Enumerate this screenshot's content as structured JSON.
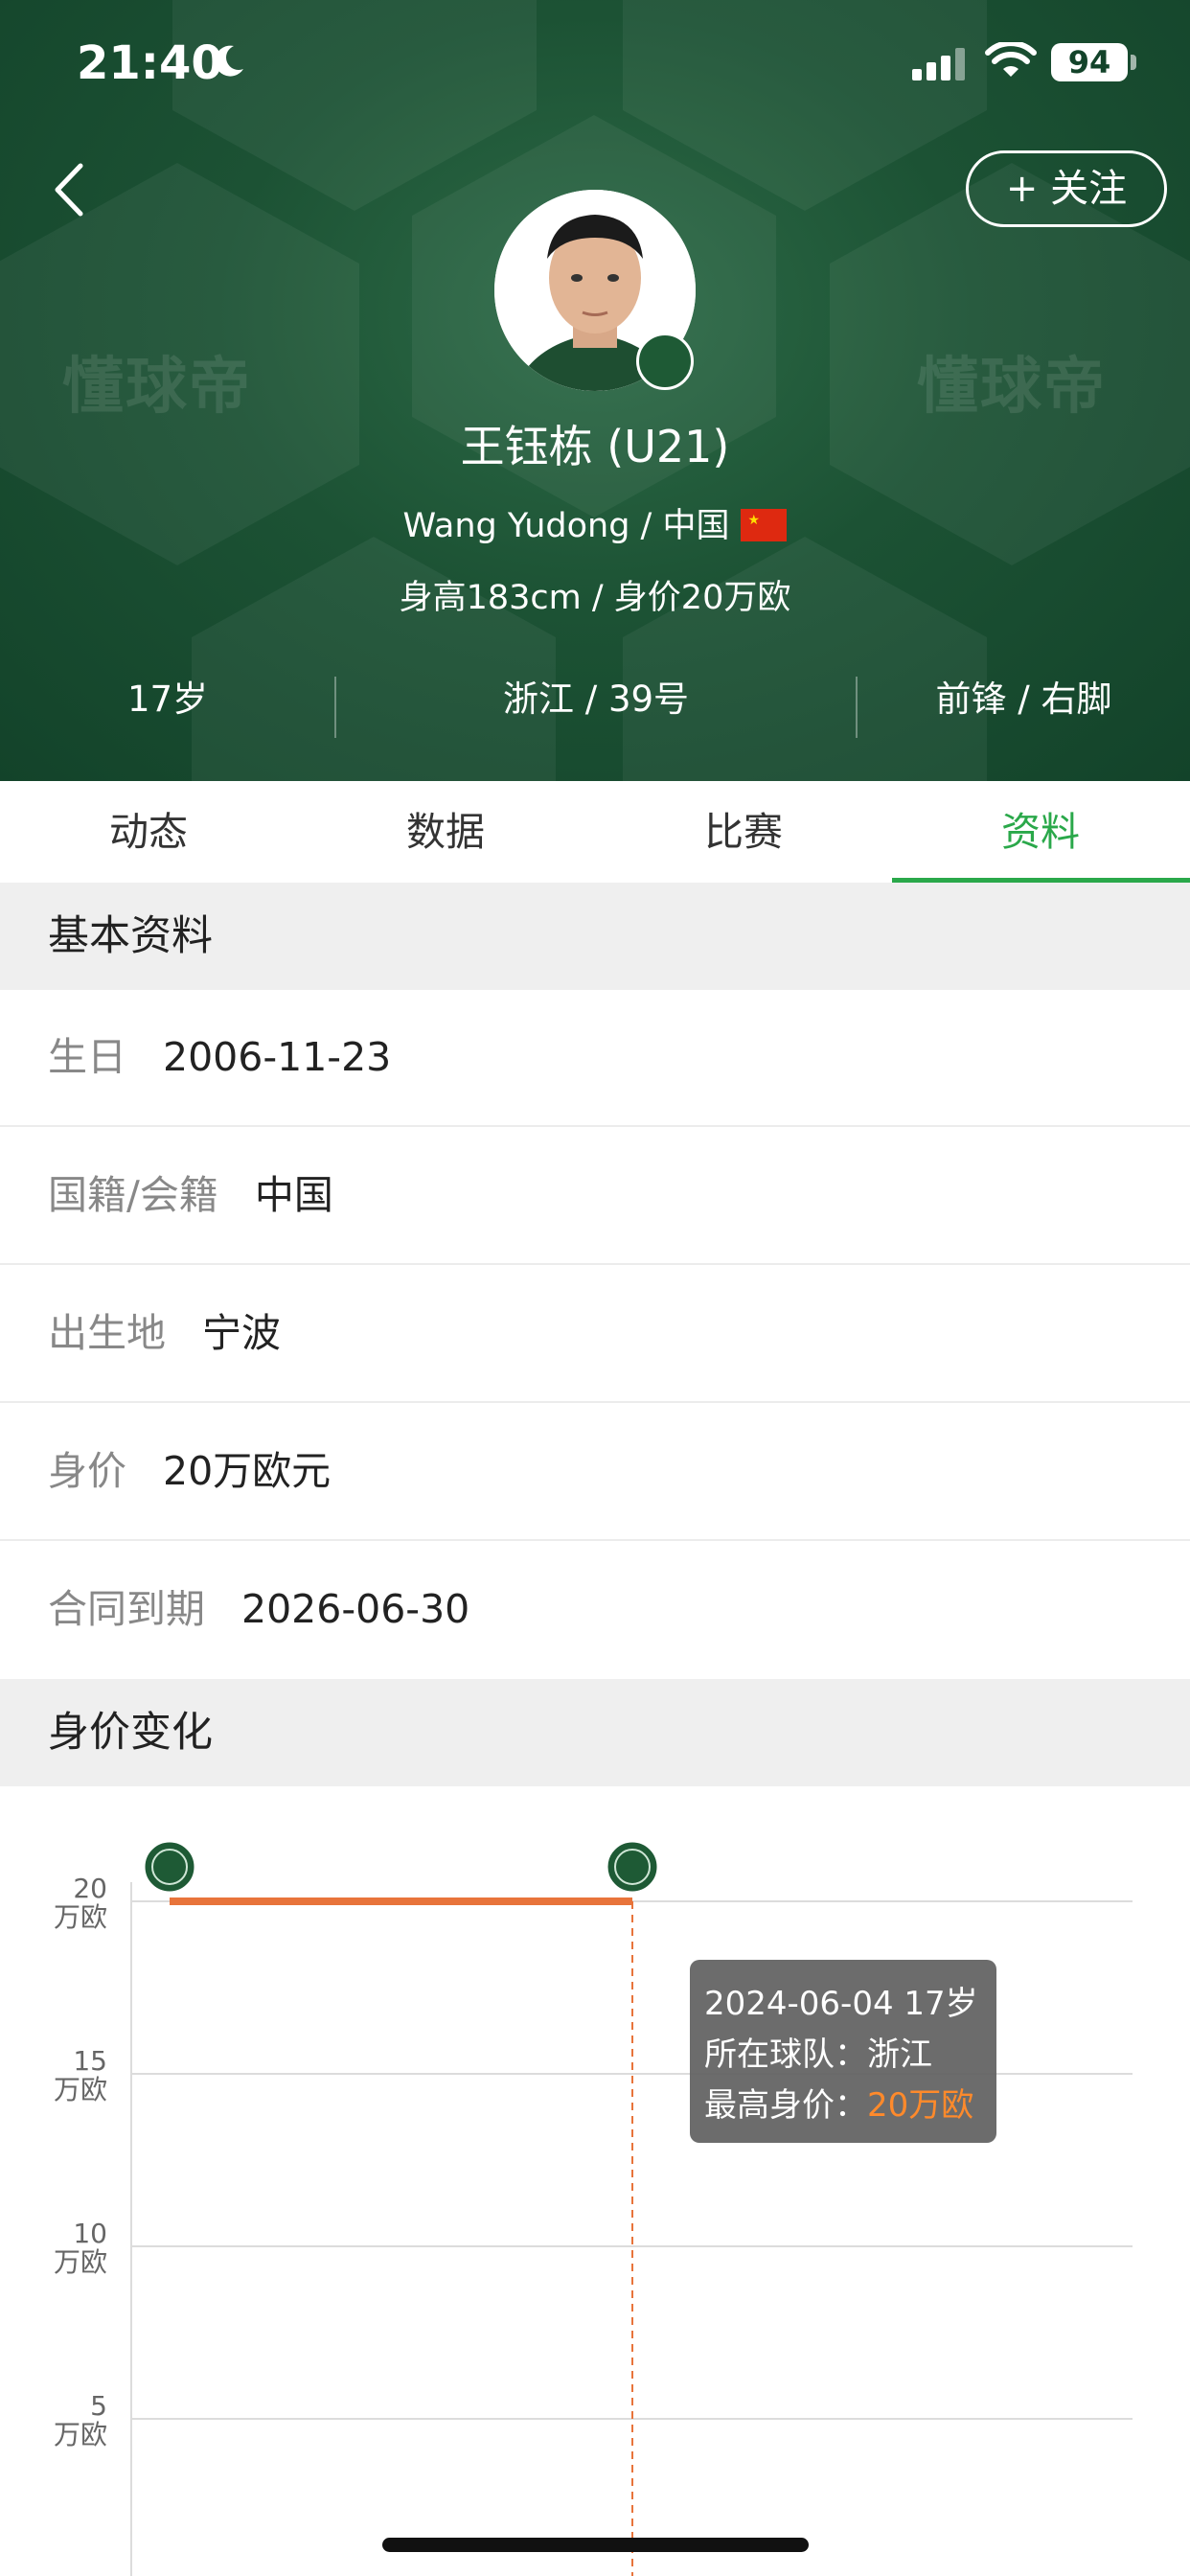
{
  "status_bar": {
    "time": "21:40",
    "battery": "94"
  },
  "header": {
    "follow_label": "+ 关注",
    "watermark": "懂球帝",
    "player_name": "王钰栋 (U21)",
    "english_name_nationality": "Wang Yudong / 中国",
    "height_value": "身高183cm / 身价20万欧",
    "stats": [
      "17岁",
      "浙江 / 39号",
      "前锋 / 右脚"
    ]
  },
  "tabs": [
    {
      "label": "动态",
      "active": false
    },
    {
      "label": "数据",
      "active": false
    },
    {
      "label": "比赛",
      "active": false
    },
    {
      "label": "资料",
      "active": true
    }
  ],
  "basic_info": {
    "title": "基本资料",
    "rows": [
      {
        "key": "生日",
        "value": "2006-11-23"
      },
      {
        "key": "国籍/会籍",
        "value": "中国"
      },
      {
        "key": "出生地",
        "value": "宁波"
      },
      {
        "key": "身价",
        "value": "20万欧元"
      },
      {
        "key": "合同到期",
        "value": "2026-06-30"
      }
    ]
  },
  "value_change": {
    "title": "身价变化",
    "tooltip": {
      "line1": "2024-06-04 17岁",
      "team_label": "所在球队：",
      "team": "浙江",
      "value_label": "最高身价：",
      "value": "20万欧"
    }
  },
  "chart_data": {
    "type": "line",
    "y_ticks": [
      {
        "value": 20,
        "label_top": "20",
        "label_unit": "万欧"
      },
      {
        "value": 15,
        "label_top": "15",
        "label_unit": "万欧"
      },
      {
        "value": 10,
        "label_top": "10",
        "label_unit": "万欧"
      },
      {
        "value": 5,
        "label_top": "5",
        "label_unit": "万欧"
      }
    ],
    "series": [
      {
        "values": [
          20,
          20
        ]
      }
    ],
    "ylim": [
      0,
      20
    ],
    "line_color": "#e8743b",
    "selected_index": 1
  },
  "colors": {
    "header_bg": "#1c5234",
    "accent_green": "#2aa84a",
    "highlight_orange": "#ff8a2b"
  }
}
